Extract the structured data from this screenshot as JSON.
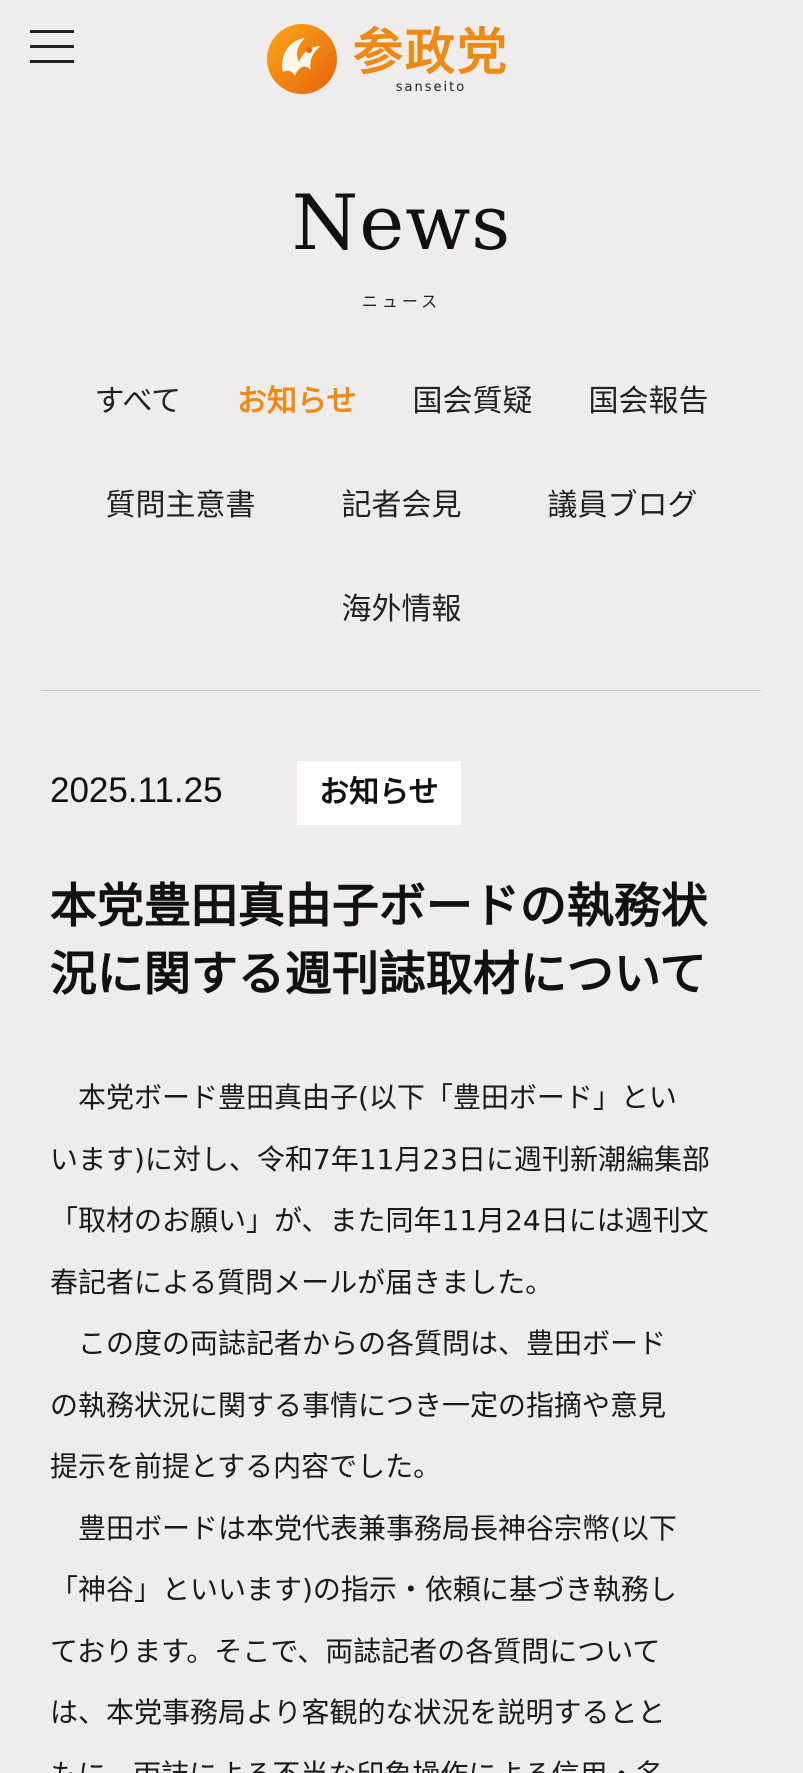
{
  "header": {
    "logo_ja": "参政党",
    "logo_en": "sanseito"
  },
  "news": {
    "title": "News",
    "subtitle": "ニュース"
  },
  "categories": [
    {
      "label": "すべて"
    },
    {
      "label": "お知らせ"
    },
    {
      "label": "国会質疑"
    },
    {
      "label": "国会報告"
    },
    {
      "label": "質問主意書"
    },
    {
      "label": "記者会見"
    },
    {
      "label": "議員ブログ"
    },
    {
      "label": "海外情報"
    }
  ],
  "active_category": "お知らせ",
  "article": {
    "date": "2025.11.25",
    "badge": "お知らせ",
    "title_lines": [
      "本党豊田真由子ボードの執務状",
      "況に関する週刊誌取材について"
    ],
    "body_lines": [
      "本党ボード豊田真由子(以下「豊田ボード」とい",
      "います)に対し、令和7年11月23日に週刊新潮編集部",
      "「取材のお願い」が、また同年11月24日には週刊文",
      "春記者による質問メールが届きました。",
      "この度の両誌記者からの各質問は、豊田ボード",
      "の執務状況に関する事情につき一定の指摘や意見",
      "提示を前提とする内容でした。",
      "豊田ボードは本党代表兼事務局長神谷宗幣(以下",
      "「神谷」といいます)の指示・依頼に基づき執務し",
      "ております。そこで、両誌記者の各質問について",
      "は、本党事務局より客観的な状況を説明するとと",
      "もに、両誌による不当な印象操作による信用・名"
    ]
  },
  "colors": {
    "accent": "#f08a12",
    "background": "#efecec",
    "badge_bg": "#ffffff"
  }
}
